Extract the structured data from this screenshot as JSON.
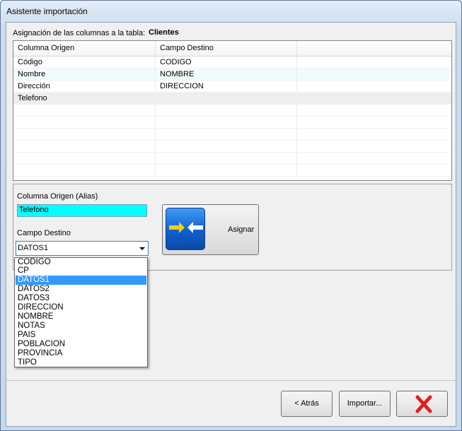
{
  "window": {
    "title": "Asistente importación"
  },
  "assignment": {
    "label": "Asignación de las columnas a la tabla:",
    "table": "Clientes"
  },
  "grid": {
    "headers": [
      "Columna Origen",
      "Campo Destino",
      ""
    ],
    "rows": [
      {
        "origin": "Código",
        "dest": "CODIGO"
      },
      {
        "origin": "Nombre",
        "dest": "NOMBRE"
      },
      {
        "origin": "Dirección",
        "dest": "DIRECCION"
      },
      {
        "origin": "Telefono",
        "dest": ""
      }
    ]
  },
  "panel": {
    "alias_label": "Columna Origen (Alias)",
    "alias_value": "Telefono",
    "dest_label": "Campo Destino",
    "dest_selected": "DATOS1",
    "assign_label": "Asignar"
  },
  "dropdown": {
    "options": [
      "CODIGO",
      "CP",
      "DATOS1",
      "DATOS2",
      "DATOS3",
      "DIRECCION",
      "NOMBRE",
      "NOTAS",
      "PAIS",
      "POBLACION",
      "PROVINCIA",
      "TIPO"
    ],
    "highlighted": "DATOS1"
  },
  "buttons": {
    "back": "< Atrás",
    "import": "Importar..."
  },
  "colors": {
    "alias_bg": "#00ffff",
    "highlight": "#3399ff",
    "cancel_x": "#e02020"
  }
}
